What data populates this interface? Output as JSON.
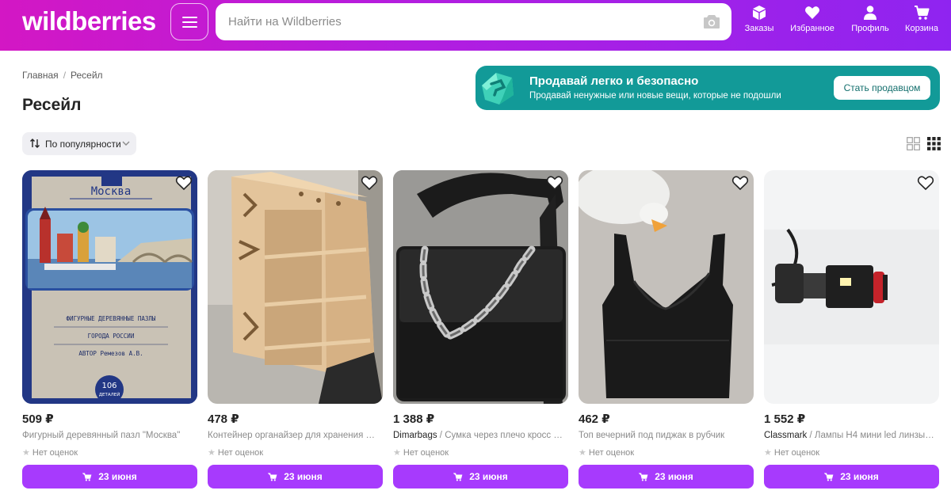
{
  "header": {
    "logo": "wildberries",
    "search_placeholder": "Найти на Wildberries",
    "nav": [
      {
        "label": "Заказы",
        "icon": "box-icon"
      },
      {
        "label": "Избранное",
        "icon": "heart-icon"
      },
      {
        "label": "Профиль",
        "icon": "user-icon"
      },
      {
        "label": "Корзина",
        "icon": "cart-icon"
      }
    ]
  },
  "breadcrumb": [
    "Главная",
    "Ресейл"
  ],
  "page_title": "Ресейл",
  "promo": {
    "title": "Продавай легко и безопасно",
    "subtitle": "Продавай ненужные или новые вещи, которые не подошли",
    "button": "Стать продавцом"
  },
  "sort": {
    "label": "По популярности"
  },
  "products": [
    {
      "price": "509 ₽",
      "brand": "",
      "name": "Фигурный деревянный пазл \"Москва\"",
      "rating": "Нет оценок",
      "delivery": "23 июня"
    },
    {
      "price": "478 ₽",
      "brand": "",
      "name": "Контейнер органайзер для хранения вл...",
      "rating": "Нет оценок",
      "delivery": "23 июня"
    },
    {
      "price": "1 388 ₽",
      "brand": "Dimarbags",
      "name": " / Сумка через плечо кросс б...",
      "rating": "Нет оценок",
      "delivery": "23 июня"
    },
    {
      "price": "462 ₽",
      "brand": "",
      "name": "Топ вечерний под пиджак в рубчик",
      "rating": "Нет оценок",
      "delivery": "23 июня"
    },
    {
      "price": "1 552 ₽",
      "brand": "Classmark",
      "name": " / Лампы H4 мини led линзы Y...",
      "rating": "Нет оценок",
      "delivery": "23 июня"
    }
  ],
  "puzzle_image_text": {
    "city": "Москва",
    "line1": "ФИГУРНЫЕ ДЕРЕВЯННЫЕ ПАЗЛЫ",
    "line2": "ГОРОДА РОССИИ",
    "line3": "АВТОР Ремезов А.В.",
    "pieces": "106",
    "pieces_label": "ДЕТАЛЕЙ"
  },
  "colors": {
    "header_start": "#d317c4",
    "header_end": "#8f24f0",
    "accent": "#a73afd",
    "promo": "#129a98"
  }
}
